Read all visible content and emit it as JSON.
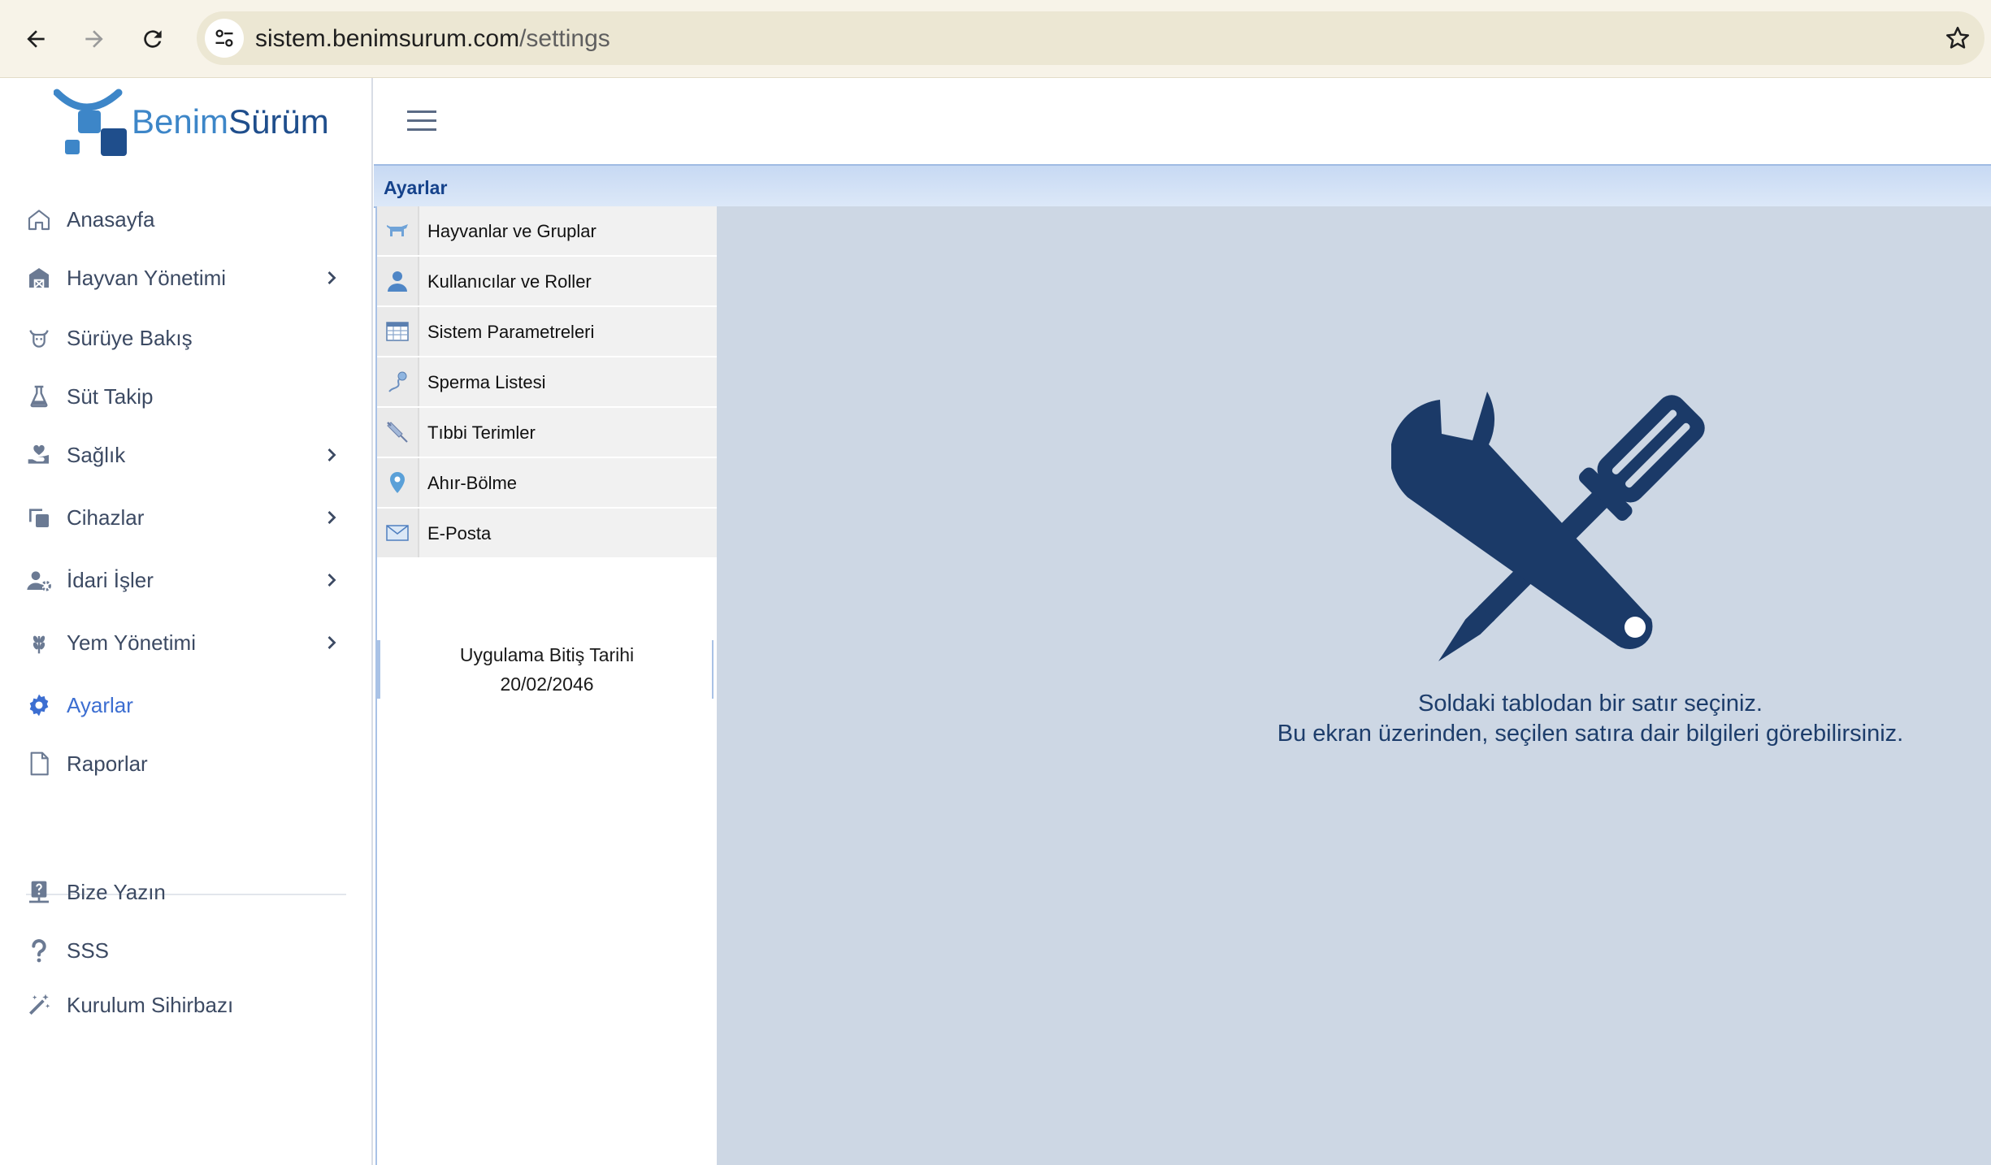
{
  "browser": {
    "url_host": "sistem.benimsurum.com",
    "url_path": "/settings"
  },
  "logo": {
    "text_light": "Benim",
    "text_dark": "Sürüm"
  },
  "sidebar": {
    "items": [
      {
        "label": "Anasayfa",
        "icon": "home-icon",
        "has_children": false,
        "active": false
      },
      {
        "label": "Hayvan Yönetimi",
        "icon": "barn-icon",
        "has_children": true,
        "active": false
      },
      {
        "label": "Sürüye Bakış",
        "icon": "cow-icon",
        "has_children": false,
        "active": false
      },
      {
        "label": "Süt Takip",
        "icon": "flask-icon",
        "has_children": false,
        "active": false
      },
      {
        "label": "Sağlık",
        "icon": "heart-hand-icon",
        "has_children": true,
        "active": false
      },
      {
        "label": "Cihazlar",
        "icon": "copy-icon",
        "has_children": true,
        "active": false
      },
      {
        "label": "İdari İşler",
        "icon": "user-gear-icon",
        "has_children": true,
        "active": false
      },
      {
        "label": "Yem Yönetimi",
        "icon": "wheat-icon",
        "has_children": true,
        "active": false
      },
      {
        "label": "Ayarlar",
        "icon": "gear-icon",
        "has_children": false,
        "active": true
      },
      {
        "label": "Raporlar",
        "icon": "file-icon",
        "has_children": false,
        "active": false
      }
    ],
    "bottom_items": [
      {
        "label": "Bize Yazın",
        "icon": "support-icon"
      },
      {
        "label": "SSS",
        "icon": "question-icon"
      },
      {
        "label": "Kurulum Sihirbazı",
        "icon": "magic-wand-icon"
      }
    ]
  },
  "panel": {
    "title": "Ayarlar"
  },
  "settings_list": [
    {
      "label": "Hayvanlar ve Gruplar",
      "icon": "cow-small-icon"
    },
    {
      "label": "Kullanıcılar ve Roller",
      "icon": "user-icon"
    },
    {
      "label": "Sistem Parametreleri",
      "icon": "table-icon"
    },
    {
      "label": "Sperma Listesi",
      "icon": "sperm-icon"
    },
    {
      "label": "Tıbbi Terimler",
      "icon": "syringe-icon"
    },
    {
      "label": "Ahır-Bölme",
      "icon": "location-pin-icon"
    },
    {
      "label": "E-Posta",
      "icon": "envelope-icon"
    }
  ],
  "expiry": {
    "label": "Uygulama Bitiş Tarihi",
    "date": "20/02/2046"
  },
  "detail": {
    "line1": "Soldaki tablodan bir satır seçiniz.",
    "line2": "Bu ekran üzerinden, seçilen satıra dair bilgileri görebilirsiniz."
  },
  "colors": {
    "accent": "#3c6ed1",
    "sidebar_text": "#3c4a63",
    "panel_header": "#15428b",
    "detail_bg": "#cdd7e4",
    "tools_icon": "#1d3d6b"
  }
}
